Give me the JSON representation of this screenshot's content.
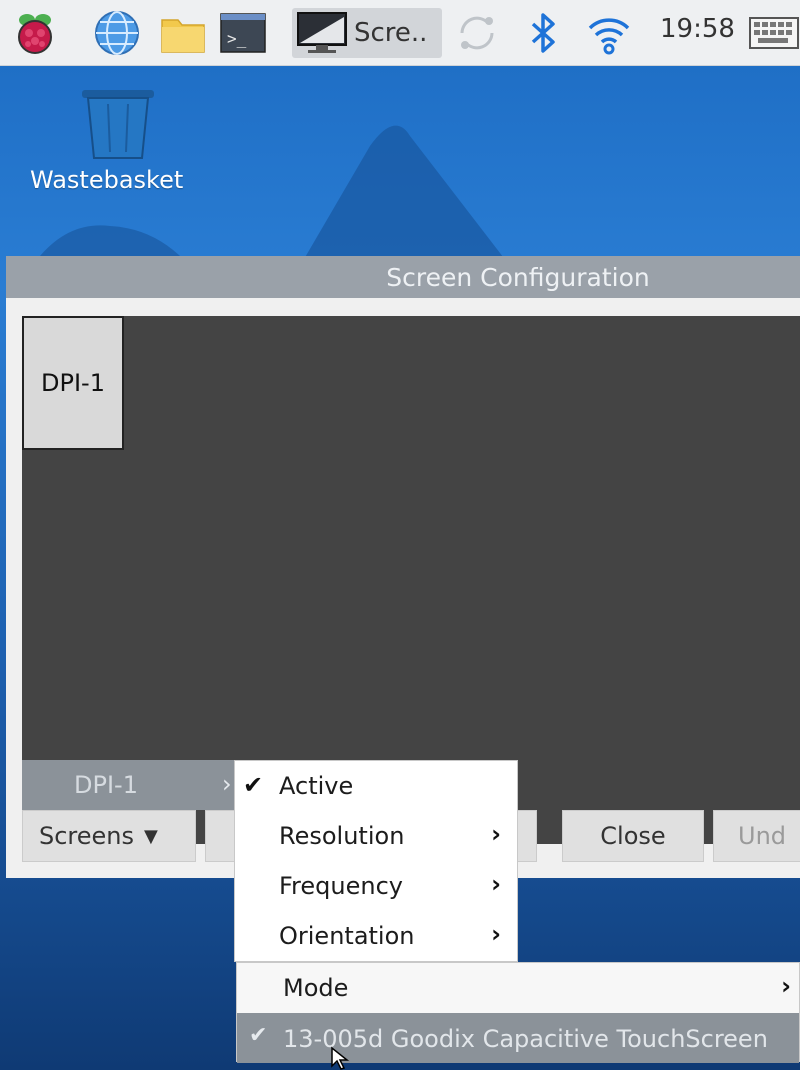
{
  "taskbar": {
    "icons": [
      "raspberry-pi-menu-icon",
      "web-browser-icon",
      "file-manager-icon",
      "terminal-icon"
    ],
    "window_label": "Scre..",
    "clock": "19:58",
    "tray_icons": [
      "sync-icon",
      "bluetooth-icon",
      "wifi-icon",
      "keyboard-icon"
    ]
  },
  "desktop": {
    "wastebasket_label": "Wastebasket"
  },
  "window": {
    "title": "Screen Configuration",
    "screen_name": "DPI-1",
    "buttons": {
      "screens": "Screens",
      "close": "Close",
      "undo": "Und"
    }
  },
  "menus": {
    "screens_item": "DPI-1",
    "dpi_menu": {
      "active": "Active",
      "resolution": "Resolution",
      "frequency": "Frequency",
      "orientation": "Orientation"
    },
    "mode_item": "Mode",
    "touch_item": "13-005d Goodix Capacitive TouchScreen"
  },
  "colors": {
    "taskbar_bg": "#eef0f2",
    "canvas_bg": "#444444",
    "menu_highlight": "#8b9299",
    "desktop_blue": "#2a7dd3"
  }
}
